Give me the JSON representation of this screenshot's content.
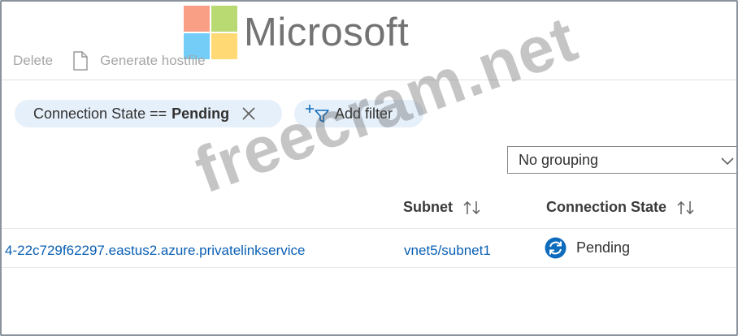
{
  "watermarks": {
    "logo_text": "Microsoft",
    "site_text": "freecram.net"
  },
  "toolbar": {
    "delete_label": "Delete",
    "generate_label": "Generate hostfile"
  },
  "filters": {
    "state_chip": {
      "prefix": "Connection State ==",
      "value": "Pending"
    },
    "add_filter_label": "Add filter"
  },
  "grouping": {
    "selected": "No grouping"
  },
  "table": {
    "columns": {
      "subnet": "Subnet",
      "connection_state": "Connection State"
    },
    "rows": [
      {
        "resource": "4-22c729f62297.eastus2.azure.privatelinkservice",
        "subnet": "vnet5/subnet1",
        "connection_state": "Pending"
      }
    ]
  },
  "colors": {
    "chip_bg": "#e6f0fa",
    "link": "#0a5fb4",
    "pending_icon": "#0f6cbd"
  }
}
